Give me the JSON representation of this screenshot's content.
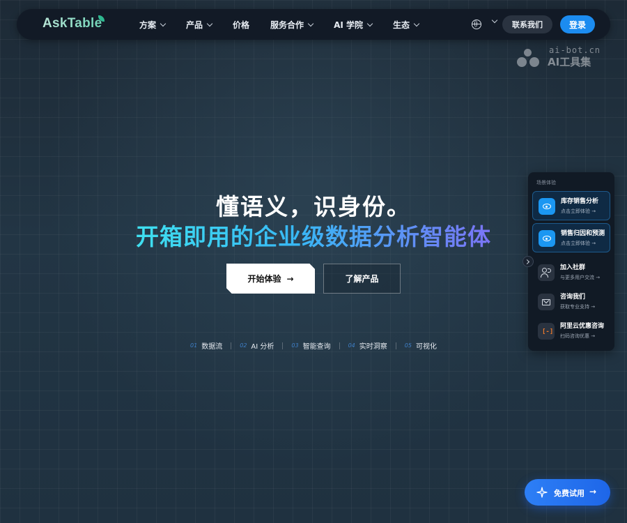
{
  "nav": {
    "logo": "AskTable",
    "menu": [
      {
        "label": "方案",
        "dropdown": true
      },
      {
        "label": "产品",
        "dropdown": true
      },
      {
        "label": "价格",
        "dropdown": false
      },
      {
        "label": "服务合作",
        "dropdown": true
      },
      {
        "label": "AI 学院",
        "dropdown": true
      },
      {
        "label": "生态",
        "dropdown": true
      }
    ],
    "contact_label": "联系我们",
    "login_label": "登录"
  },
  "watermark": {
    "top": "ai-bot.cn",
    "bottom": "AI工具集"
  },
  "hero": {
    "line1": "懂语义，识身份。",
    "line2": "开箱即用的企业级数据分析智能体",
    "primary_button": "开始体验",
    "secondary_button": "了解产品",
    "features": [
      {
        "num": "01",
        "label": "数据流"
      },
      {
        "num": "02",
        "label": "AI 分析"
      },
      {
        "num": "03",
        "label": "智能查询"
      },
      {
        "num": "04",
        "label": "实时洞察"
      },
      {
        "num": "05",
        "label": "可视化"
      }
    ]
  },
  "side_panel": {
    "title": "场景体验",
    "cards": [
      {
        "title": "库存销售分析",
        "sub": "点击立即体验 →"
      },
      {
        "title": "销售归因和预测",
        "sub": "点击立即体验 →"
      }
    ],
    "rows": [
      {
        "title": "加入社群",
        "sub": "与更多用户交流 →",
        "icon": "users-icon"
      },
      {
        "title": "咨询我们",
        "sub": "获取专业支持 →",
        "icon": "mail-icon"
      },
      {
        "title": "阿里云优惠咨询",
        "sub": "扫码咨询优惠 →",
        "icon": "aliyun-icon"
      }
    ]
  },
  "trial_button": "免费试用",
  "colors": {
    "accent": "#1c8cf0",
    "gradient_start": "#3fe0f0",
    "gradient_end": "#7b74f6"
  }
}
